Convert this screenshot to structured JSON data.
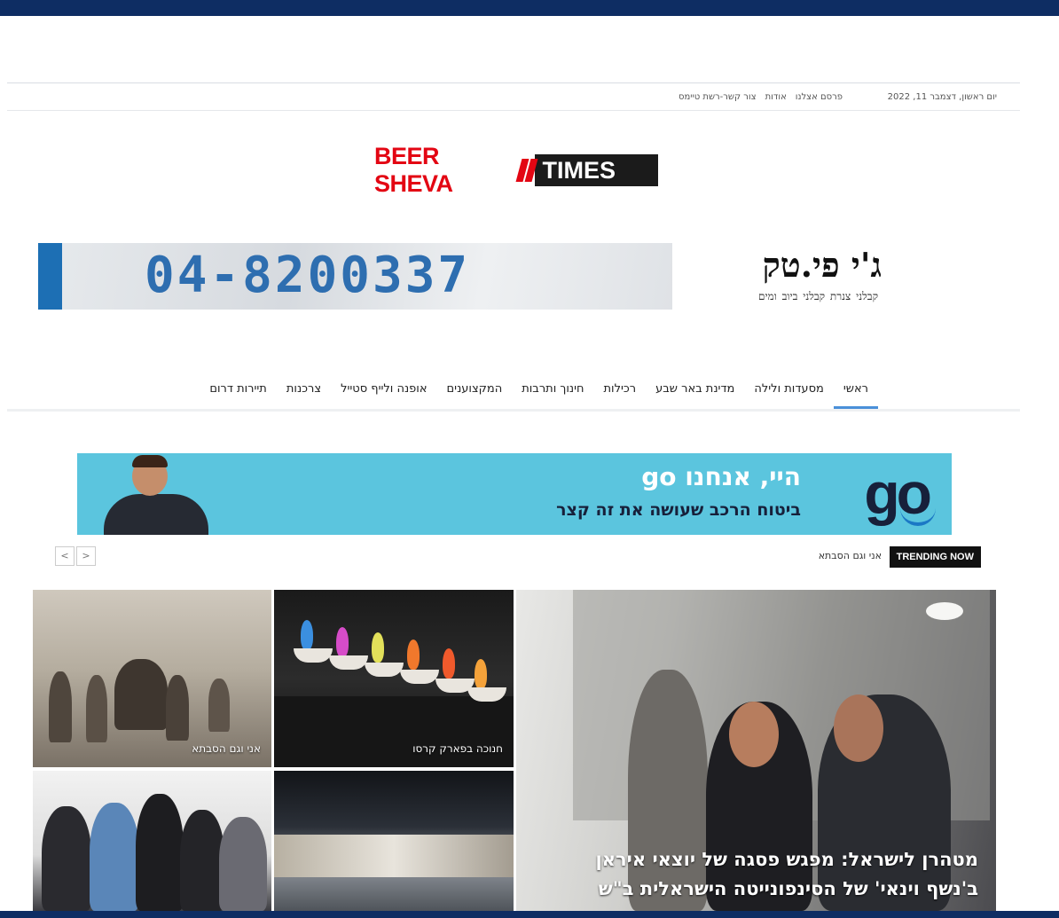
{
  "topbar": {
    "date": "יום ראשון, דצמבר 11, 2022",
    "links": [
      "פרסם אצלנו",
      "אודות",
      "צור קשר-רשת טיימס"
    ]
  },
  "logo": {
    "part1": "BEER SHEVA",
    "part2": "TIMES"
  },
  "ad_top": {
    "phone": "04-8200337",
    "brand": "ג'י פי.טק",
    "tagline": "קבלני צנרת   קבלני ביוב ומים"
  },
  "nav": {
    "items": [
      "ראשי",
      "מסעדות ולילה",
      "מדינת באר שבע",
      "רכילות",
      "חינוך ותרבות",
      "המקצוענים",
      "אופנה ולייף סטייל",
      "צרכנות",
      "תיירות דרום"
    ]
  },
  "ad_go": {
    "logo": "go",
    "line1": "היי, אנחנו go",
    "line2": "ביטוח הרכב שעושה את זה קצר"
  },
  "trending": {
    "badge": "TRENDING NOW",
    "headline": "אני וגם הסבתא",
    "prev": "<",
    "next": ">"
  },
  "tiles": {
    "sepia": "אני וגם הסבתא",
    "fire": "חנוכה בפארק קרסו",
    "main": "מטהרן לישראל: מפגש פסגה של יוצאי איראן ב'נשף וינאי' של הסינפונייטה הישראלית ב\"ש"
  },
  "colors": {
    "frame": "#0e2d63",
    "brand_red": "#e30613",
    "go_blue": "#5bc5de",
    "nav_active": "#4a90d9"
  }
}
